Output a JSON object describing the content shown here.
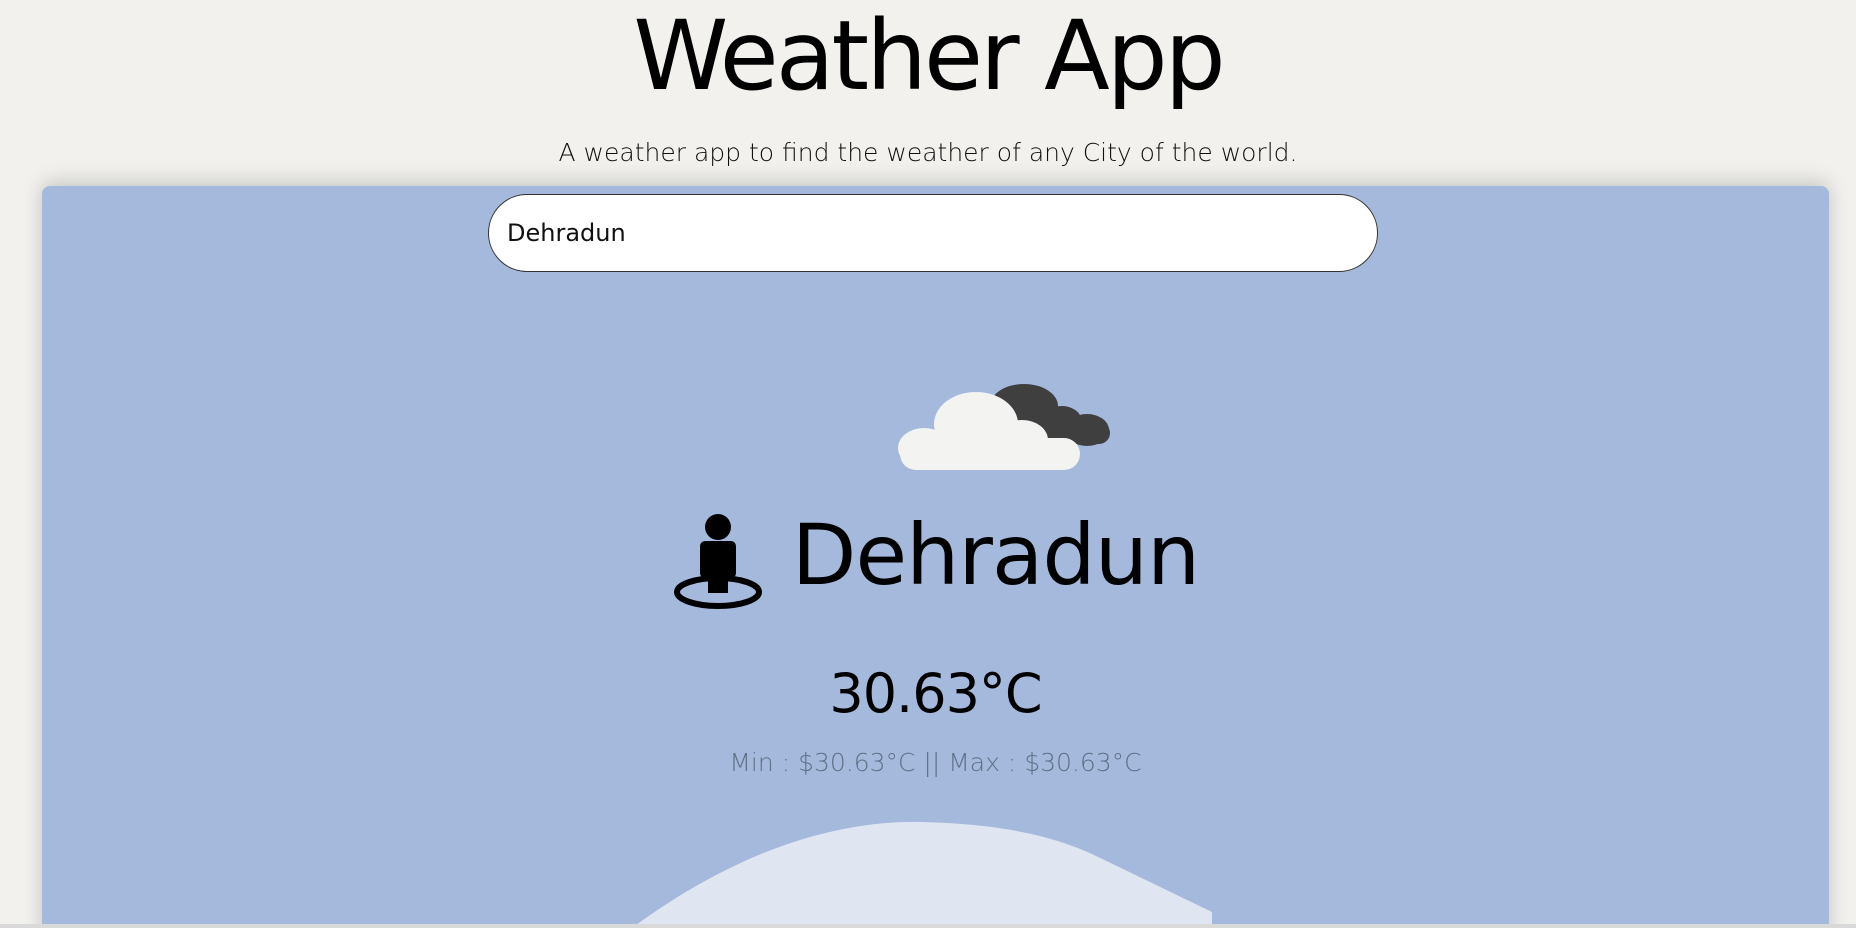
{
  "header": {
    "title": "Weather App",
    "subtitle": "A weather app to find the weather of any City of the world."
  },
  "search": {
    "value": "Dehradun",
    "placeholder": ""
  },
  "weather": {
    "icon": "cloudy-icon",
    "location_icon": "person-location-icon",
    "city": "Dehradun",
    "temperature": "30.63°C",
    "minmax": "Min : $30.63°C || Max : $30.63°C"
  },
  "colors": {
    "page_background": "#f2f1ee",
    "card_background": "#a5b9dd",
    "hill": "#dfe5f1",
    "minmax_text": "#5f6f86"
  }
}
